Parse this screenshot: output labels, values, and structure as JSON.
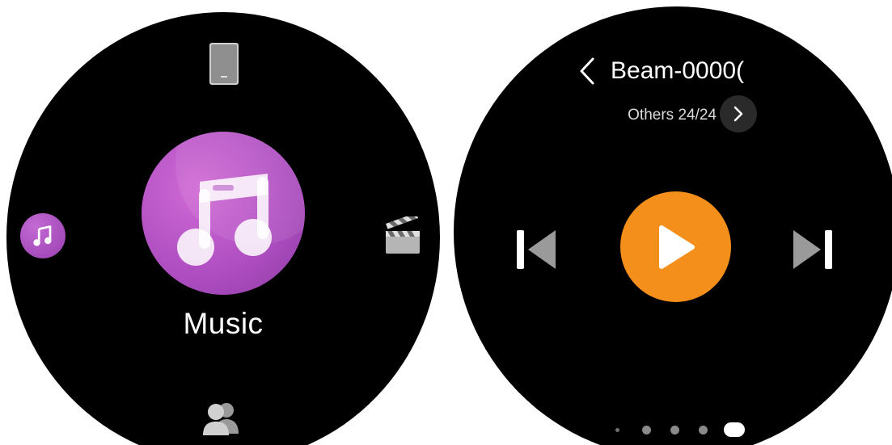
{
  "launcher": {
    "selected_app_label": "Music",
    "icons": [
      "tablet-icon",
      "music-icon",
      "clapperboard-icon",
      "contacts-icon"
    ]
  },
  "player": {
    "device_name": "Beam-0000(",
    "source_label": "Others 24/24",
    "controls": [
      "previous-track-icon",
      "play-icon",
      "next-track-icon"
    ],
    "page_count": 5,
    "active_page": 5
  },
  "colors": {
    "background": "#000000",
    "music_purple": "#b04fc2",
    "play_orange": "#f38f1a",
    "control_gray": "#9a9a9a"
  }
}
